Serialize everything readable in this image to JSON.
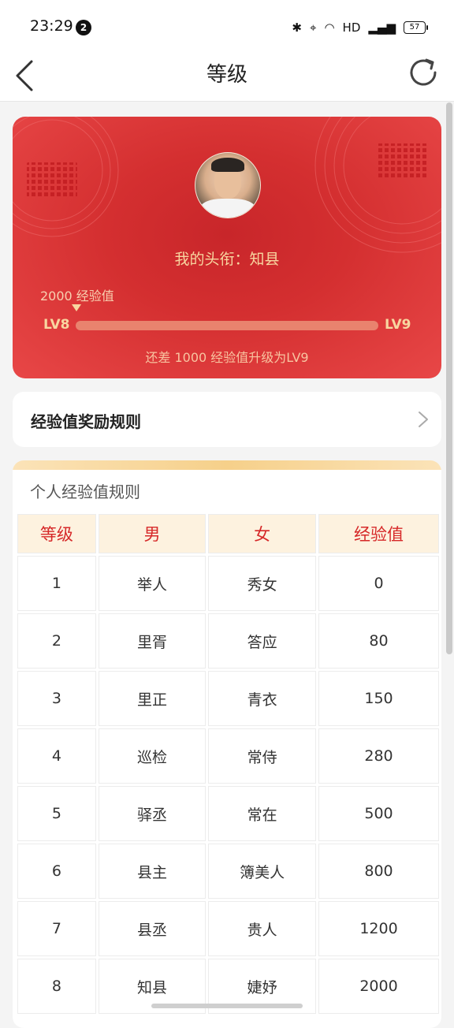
{
  "status_bar": {
    "time": "23:29",
    "notif_count": "2",
    "network": "HD",
    "battery": "57"
  },
  "nav": {
    "title": "等级"
  },
  "card": {
    "title_text": "我的头衔：知县",
    "current_exp_label": "2000 经验值",
    "level_from": "LV8",
    "level_to": "LV9",
    "progress": 0.0,
    "hint": "还差 1000 经验值升级为LV9"
  },
  "rule_link": {
    "label": "经验值奖励规则"
  },
  "rules": {
    "title": "个人经验值规则",
    "headers": [
      "等级",
      "男",
      "女",
      "经验值"
    ],
    "rows": [
      [
        "1",
        "举人",
        "秀女",
        "0"
      ],
      [
        "2",
        "里胥",
        "答应",
        "80"
      ],
      [
        "3",
        "里正",
        "青衣",
        "150"
      ],
      [
        "4",
        "巡检",
        "常侍",
        "280"
      ],
      [
        "5",
        "驿丞",
        "常在",
        "500"
      ],
      [
        "6",
        "县主",
        "簿美人",
        "800"
      ],
      [
        "7",
        "县丞",
        "贵人",
        "1200"
      ],
      [
        "8",
        "知县",
        "婕妤",
        "2000"
      ]
    ]
  },
  "colors": {
    "card_red": "#d42f30",
    "accent_gold": "#f8d6a0",
    "table_header_red": "#d62828"
  }
}
